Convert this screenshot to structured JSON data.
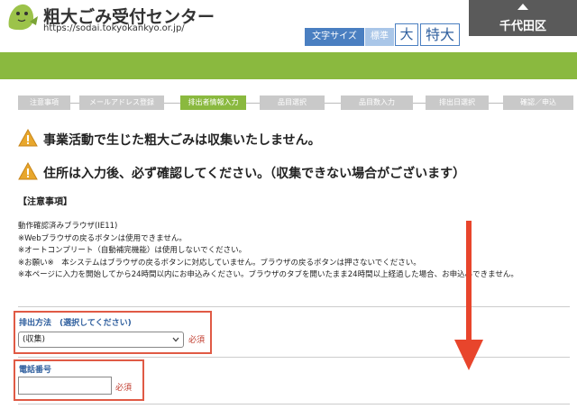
{
  "header": {
    "site_title": "粗大ごみ受付センター",
    "site_url": "https://sodai.tokyokankyo.or.jp/",
    "font_size": {
      "label": "文字サイズ",
      "normal": "標準",
      "large": "大",
      "xlarge": "特大"
    },
    "ward": "千代田区"
  },
  "steps": [
    {
      "label": "注意事項",
      "active": false
    },
    {
      "label": "メールアドレス登録",
      "active": false
    },
    {
      "label": "排出者情報入力",
      "active": true
    },
    {
      "label": "品目選択",
      "active": false
    },
    {
      "label": "品目数入力",
      "active": false
    },
    {
      "label": "排出日選択",
      "active": false
    },
    {
      "label": "確認／申込",
      "active": false
    }
  ],
  "warnings": [
    "事業活動で生じた粗大ごみは収集いたしません。",
    "住所は入力後、必ず確認してください。（収集できない場合がございます）"
  ],
  "notes": {
    "heading": "【注意事項】",
    "lines": [
      "動作確認済みブラウザ(IE11)",
      "※Webブラウザの戻るボタンは使用できません。",
      "※オートコンプリート（自動補完機能）は使用しないでください。",
      "※お願い※　本システムはブラウザの戻るボタンに対応していません。ブラウザの戻るボタンは押さないでください。",
      "※本ページに入力を開始してから24時間以内にお申込みください。ブラウザのタブを開いたまま24時間以上経過した場合、お申込みできません。"
    ]
  },
  "form": {
    "method": {
      "label": "排出方法　(選択してください)",
      "value": "(収集)",
      "required": "必須"
    },
    "phone": {
      "label": "電話番号",
      "value": "",
      "required": "必須"
    }
  },
  "colors": {
    "green": "#8ab93f",
    "blue": "#4a7fc1",
    "red": "#e05a45",
    "step_gray": "#c9c9c9"
  }
}
